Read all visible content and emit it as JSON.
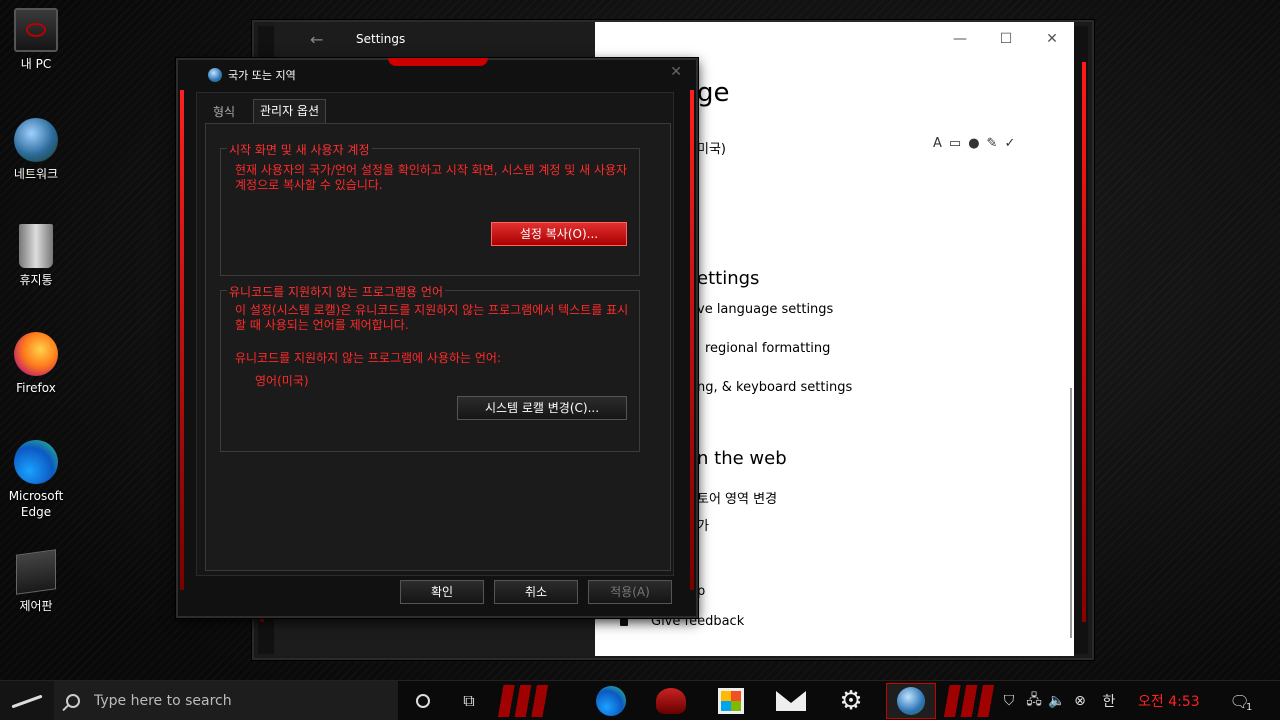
{
  "desktop": {
    "icons": [
      {
        "label": "내 PC"
      },
      {
        "label": "네트워크"
      },
      {
        "label": "휴지통"
      },
      {
        "label": "Firefox"
      },
      {
        "label": "Microsoft Edge"
      },
      {
        "label": "제어판"
      }
    ]
  },
  "settings": {
    "title": "Settings",
    "back_icon": "←",
    "min_icon": "—",
    "max_icon": "☐",
    "close_icon": "✕",
    "heading_partial": "ge",
    "lang_partial": "미국)",
    "related_heading_partial": "ettings",
    "links": [
      "ve language settings",
      "regional formatting",
      "ng, & keyboard settings"
    ],
    "web_heading_partial": "n the web",
    "web_links": [
      "토어 영역 변경",
      "가"
    ],
    "feedback": "Give feedback",
    "help_partial": "p"
  },
  "dialog": {
    "title": "국가 또는 지역",
    "tabs": [
      {
        "label": "형식"
      },
      {
        "label": "관리자 옵션"
      }
    ],
    "group1": {
      "title": "시작 화면 및 새 사용자 계정",
      "description": "현재 사용자의 국가/언어 설정을 확인하고 시작 화면, 시스템 계정 및 새 사용자 계정으로 복사할 수 있습니다.",
      "button": "설정 복사(O)..."
    },
    "group2": {
      "title": "유니코드를 지원하지 않는 프로그램용 언어",
      "description": "이 설정(시스템 로캘)은 유니코드를 지원하지 않는 프로그램에서 텍스트를 표시할 때 사용되는 언어를 제어합니다.",
      "current_label": "유니코드를 지원하지 않는 프로그램에 사용하는 언어:",
      "current_value": "영어(미국)",
      "button": "시스템 로캘 변경(C)..."
    },
    "ok": "확인",
    "cancel": "취소",
    "apply": "적용(A)"
  },
  "taskbar": {
    "search_placeholder": "Type here to search",
    "clock": "오전 4:53",
    "notification_count": "1"
  },
  "colors": {
    "accent_red": "#ff2a2a",
    "dialog_bg": "#1b1b1b",
    "settings_bg": "#ffffff"
  }
}
